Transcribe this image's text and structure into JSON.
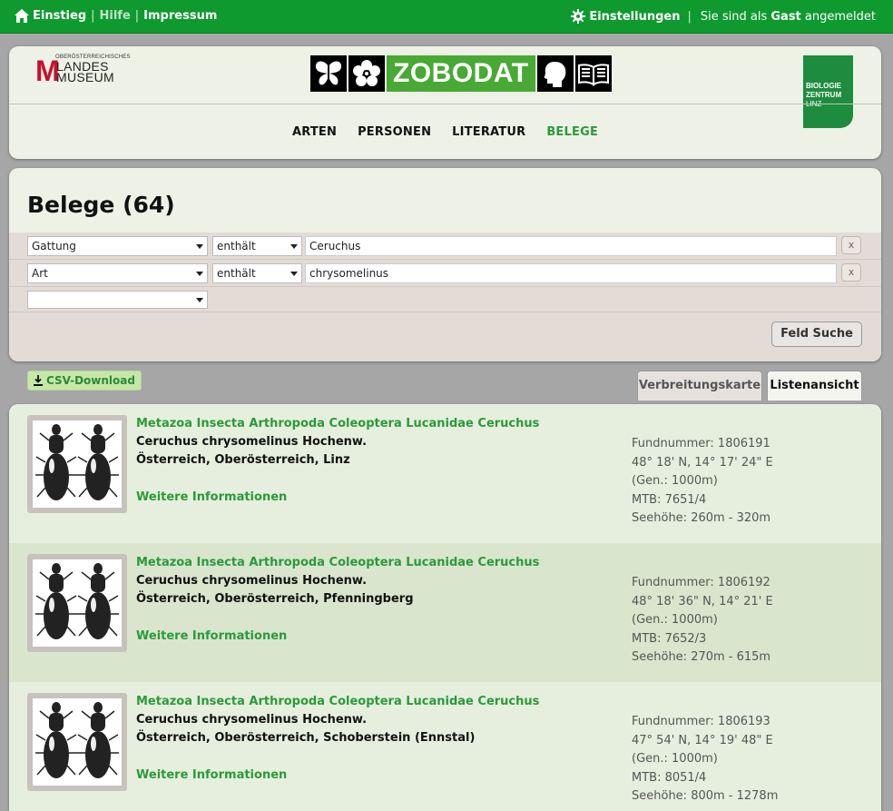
{
  "topbar": {
    "home": "Einstieg",
    "help": "Hilfe",
    "impressum": "Impressum",
    "settings": "Einstellungen",
    "login_prefix": "Sie sind als",
    "login_user": "Gast",
    "login_suffix": "angemeldet"
  },
  "header": {
    "museum_logo": {
      "small": "OBERÖSTERREICHISCHES",
      "line1": "LANDES",
      "line2": "MUSEUM",
      "m": "M"
    },
    "zobodat_word": "ZOBODAT",
    "bz_logo": {
      "line1": "BIOLOGIE",
      "line2": "ZENTRUM",
      "line3": "LINZ"
    },
    "nav": [
      "ARTEN",
      "PERSONEN",
      "LITERATUR",
      "BELEGE"
    ],
    "active_nav": "BELEGE"
  },
  "search": {
    "title": "Belege (64)",
    "filters": [
      {
        "field": "Gattung",
        "op": "enthält",
        "value": "Ceruchus"
      },
      {
        "field": "Art",
        "op": "enthält",
        "value": "chrysomelinus"
      }
    ],
    "empty_field": "",
    "remove_label": "x",
    "submit": "Feld Suche"
  },
  "toolbar": {
    "csv": "CSV-Download",
    "tabs": [
      "Verbreitungskarte",
      "Listenansicht"
    ],
    "active_tab": "Listenansicht"
  },
  "results": [
    {
      "taxonomy": "Metazoa Insecta Arthropoda Coleoptera Lucanidae Ceruchus",
      "species": "Ceruchus chrysomelinus Hochenw.",
      "location": "Österreich, Oberösterreich, Linz",
      "more": "Weitere Informationen",
      "fundnummer": "Fundnummer: 1806191",
      "coords": "48° 18' N, 14° 17' 24\" E",
      "gen": "(Gen.: 1000m)",
      "mtb": "MTB: 7651/4",
      "seehoehe": "Seehöhe: 260m - 320m"
    },
    {
      "taxonomy": "Metazoa Insecta Arthropoda Coleoptera Lucanidae Ceruchus",
      "species": "Ceruchus chrysomelinus Hochenw.",
      "location": "Österreich, Oberösterreich, Pfenningberg",
      "more": "Weitere Informationen",
      "fundnummer": "Fundnummer: 1806192",
      "coords": "48° 18' 36\" N, 14° 21' E",
      "gen": "(Gen.: 1000m)",
      "mtb": "MTB: 7652/3",
      "seehoehe": "Seehöhe: 270m - 615m"
    },
    {
      "taxonomy": "Metazoa Insecta Arthropoda Coleoptera Lucanidae Ceruchus",
      "species": "Ceruchus chrysomelinus Hochenw.",
      "location": "Österreich, Oberösterreich, Schoberstein (Ennstal)",
      "more": "Weitere Informationen",
      "fundnummer": "Fundnummer: 1806193",
      "coords": "47° 54' N, 14° 19' 48\" E",
      "gen": "(Gen.: 1000m)",
      "mtb": "MTB: 8051/4",
      "seehoehe": "Seehöhe: 800m - 1278m"
    }
  ],
  "colors": {
    "brand_green": "#0e9a2e",
    "link_green": "#2a9a3a",
    "zobodat_green": "#48a934",
    "museum_red": "#c8102e"
  },
  "icons": [
    "home-icon",
    "gear-icon",
    "butterfly-icon",
    "flower-icon",
    "head-icon",
    "book-icon",
    "download-icon",
    "beetle-image"
  ]
}
